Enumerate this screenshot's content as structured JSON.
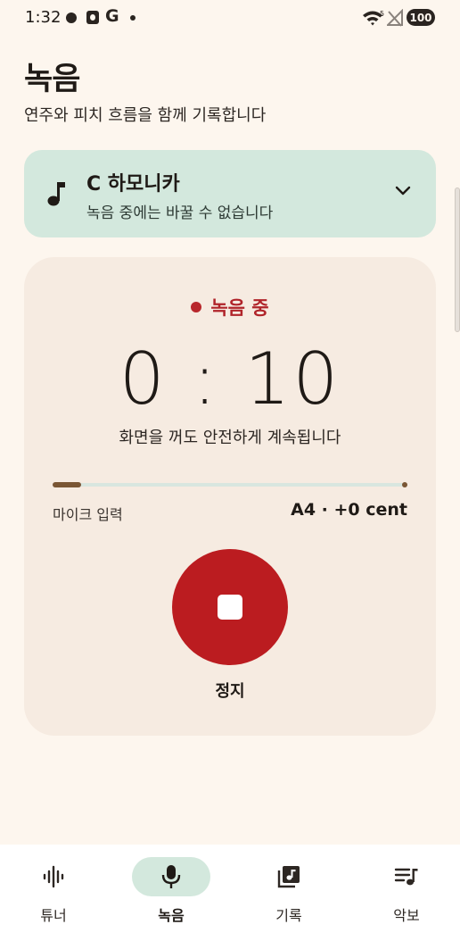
{
  "status_bar": {
    "time": "1:32",
    "google_glyph": "G",
    "battery": "100"
  },
  "page": {
    "title": "녹음",
    "subtitle": "연주와 피치 흐름을 함께 기록합니다"
  },
  "instrument": {
    "name": "C 하모니카",
    "note": "녹음 중에는 바꿀 수 없습니다",
    "icon": "music-note-icon"
  },
  "recording": {
    "status": "녹음 중",
    "timer": "0 : 10",
    "hint": "화면을 꺼도 안전하게 계속됩니다",
    "mic_label": "마이크 입력",
    "pitch": "A4 · +0 cent",
    "input_level": 0.08,
    "stop_label": "정지"
  },
  "nav": {
    "items": [
      {
        "label": "튜너",
        "icon": "waveform-icon",
        "active": false
      },
      {
        "label": "녹음",
        "icon": "mic-icon",
        "active": true
      },
      {
        "label": "기록",
        "icon": "library-music-icon",
        "active": false
      },
      {
        "label": "악보",
        "icon": "queue-music-icon",
        "active": false
      }
    ]
  },
  "colors": {
    "background": "#fdf6ee",
    "accent_red": "#bb1c20",
    "mint": "#d3e8dd",
    "card": "#f6ebe1",
    "level": "#7a5634"
  }
}
